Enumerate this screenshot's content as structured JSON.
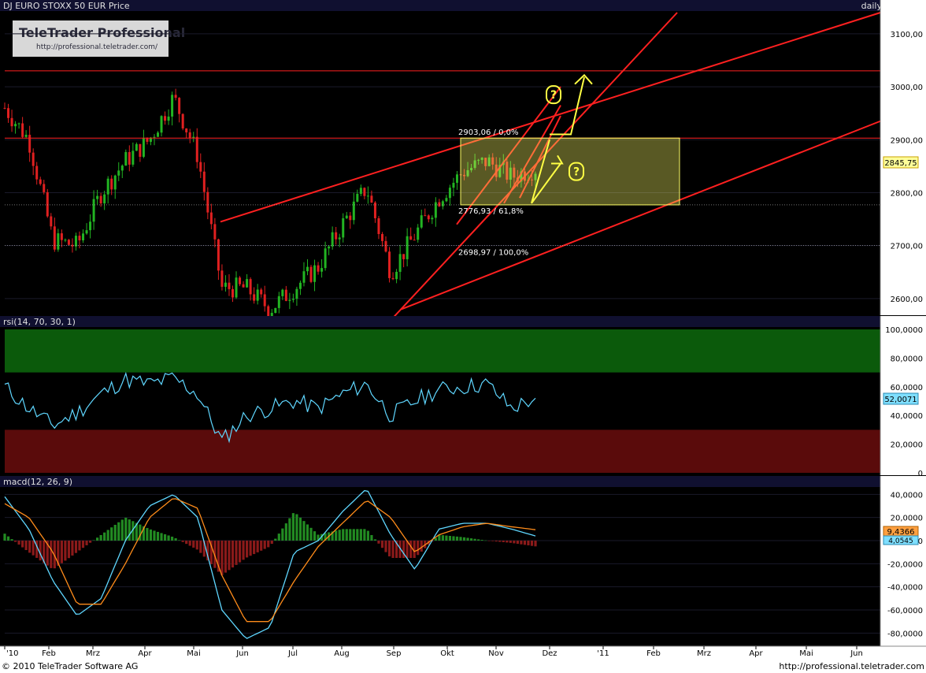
{
  "header": {
    "title": "DJ EURO STOXX 50 EUR Price",
    "period": "daily"
  },
  "logo": {
    "brand": "TeleTrader Professional",
    "url": "http://professional.teletrader.com/"
  },
  "footer": {
    "copyright": "© 2010 TeleTrader Software AG",
    "url": "http://professional.teletrader.com"
  },
  "colors": {
    "background": "#000000",
    "axis_bg": "#ffffff",
    "up_candle": "#22b422",
    "down_candle": "#e02020",
    "trendline": "#ff2020",
    "fib_box": "#ffff66",
    "rsi_line": "#5fd7ff",
    "rsi_overbought_zone": "#0b5a0b",
    "rsi_oversold_zone": "#5a0b0b",
    "macd_line": "#5fd7ff",
    "signal_line": "#ff8c1a",
    "hist_up": "#228b22",
    "hist_down": "#8b1a1a"
  },
  "chart_data": [
    {
      "type": "line",
      "title": "DJ EURO STOXX 50 EUR Price",
      "style": "candlestick",
      "x_labels": [
        "'10",
        "Feb",
        "Mrz",
        "Apr",
        "Mai",
        "Jun",
        "Jul",
        "Aug",
        "Sep",
        "Okt",
        "Nov",
        "Dez",
        "'11",
        "Feb",
        "Mrz",
        "Apr",
        "Mai",
        "Jun"
      ],
      "y_ticks": [
        "3100,00",
        "3000,00",
        "2900,00",
        "2800,00",
        "2700,00",
        "2600,00"
      ],
      "ylim": [
        2570,
        3140
      ],
      "close_series": {
        "x": [
          "'10",
          "Jan mid",
          "Feb start",
          "Feb mid",
          "Mrz start",
          "Mrz mid",
          "Apr start",
          "Apr mid",
          "Mai start",
          "Mai mid",
          "Jun start",
          "Jun mid",
          "Jul start",
          "Jul mid",
          "Aug start",
          "Aug mid",
          "Sep start",
          "Sep mid",
          "Okt start",
          "Okt mid",
          "Nov start",
          "Nov mid",
          "Nov end"
        ],
        "y": [
          2960,
          2900,
          2710,
          2700,
          2800,
          2860,
          2900,
          2980,
          2870,
          2620,
          2620,
          2580,
          2620,
          2660,
          2740,
          2810,
          2650,
          2720,
          2790,
          2840,
          2860,
          2830,
          2845.75
        ]
      },
      "fib_levels": [
        {
          "label": "2903,06 / 0,0%",
          "value": 2903.06
        },
        {
          "label": "2776,93 / 61,8%",
          "value": 2776.93
        },
        {
          "label": "2698,97 / 100,0%",
          "value": 2698.97
        }
      ],
      "horizontal_lines": [
        3030,
        2903.06
      ],
      "last_value_label": "2845,75",
      "annotations": [
        "?",
        "?"
      ]
    },
    {
      "type": "line",
      "title": "rsi(14, 70, 30, 1)",
      "y_ticks": [
        "100,0000",
        "80,0000",
        "60,0000",
        "40,0000",
        "20,0000",
        "0"
      ],
      "ylim": [
        0,
        100
      ],
      "zones": {
        "overbought": [
          70,
          100
        ],
        "oversold": [
          0,
          30
        ]
      },
      "series": [
        {
          "name": "rsi",
          "x": [
            "'10",
            "Jan mid",
            "Feb start",
            "Feb mid",
            "Mrz start",
            "Mrz mid",
            "Apr start",
            "Apr mid",
            "Mai start",
            "Mai mid",
            "Jun start",
            "Jun mid",
            "Jul start",
            "Jul mid",
            "Aug start",
            "Aug mid",
            "Sep start",
            "Sep mid",
            "Okt start",
            "Okt mid",
            "Nov start",
            "Nov mid",
            "Nov end"
          ],
          "values": [
            60,
            45,
            33,
            42,
            55,
            65,
            62,
            66,
            55,
            22,
            40,
            45,
            50,
            45,
            55,
            62,
            40,
            50,
            58,
            60,
            62,
            45,
            52.0071
          ]
        }
      ],
      "last_value_label": "52,0071"
    },
    {
      "type": "line",
      "title": "macd(12, 26, 9)",
      "y_ticks": [
        "40,0000",
        "20,0000",
        "0",
        "-20,0000",
        "-40,0000",
        "-60,0000",
        "-80,0000"
      ],
      "ylim": [
        -90,
        45
      ],
      "series": [
        {
          "name": "macd",
          "values": [
            38,
            10,
            -35,
            -65,
            -50,
            0,
            30,
            40,
            20,
            -60,
            -85,
            -75,
            -10,
            0,
            25,
            45,
            5,
            -25,
            10,
            15,
            15,
            10,
            4
          ]
        },
        {
          "name": "signal",
          "values": [
            32,
            20,
            -10,
            -55,
            -55,
            -20,
            20,
            37,
            28,
            -30,
            -70,
            -70,
            -35,
            -5,
            15,
            35,
            20,
            -10,
            5,
            12,
            15,
            12,
            9.4366
          ]
        }
      ],
      "histogram": [
        6,
        -10,
        -25,
        -10,
        5,
        20,
        10,
        3,
        -8,
        -30,
        -15,
        -5,
        25,
        5,
        10,
        10,
        -15,
        -15,
        5,
        3,
        0,
        -2,
        -5
      ],
      "last_value_labels": [
        "9,4366",
        "4,0545"
      ]
    }
  ]
}
